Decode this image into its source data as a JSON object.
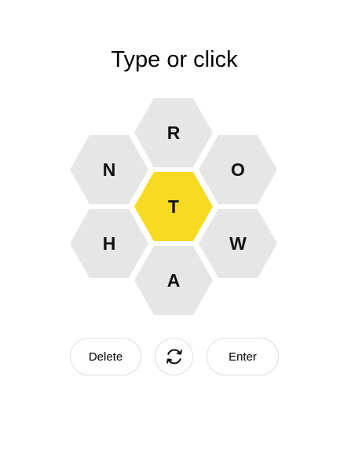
{
  "prompt": "Type or click",
  "hive": {
    "center_letter": "T",
    "outer_letters": [
      "R",
      "O",
      "W",
      "A",
      "H",
      "N"
    ]
  },
  "buttons": {
    "delete_label": "Delete",
    "shuffle_icon": "shuffle-icon",
    "enter_label": "Enter"
  },
  "colors": {
    "center_cell": "#f7da21",
    "outer_cell": "#e6e6e6"
  }
}
